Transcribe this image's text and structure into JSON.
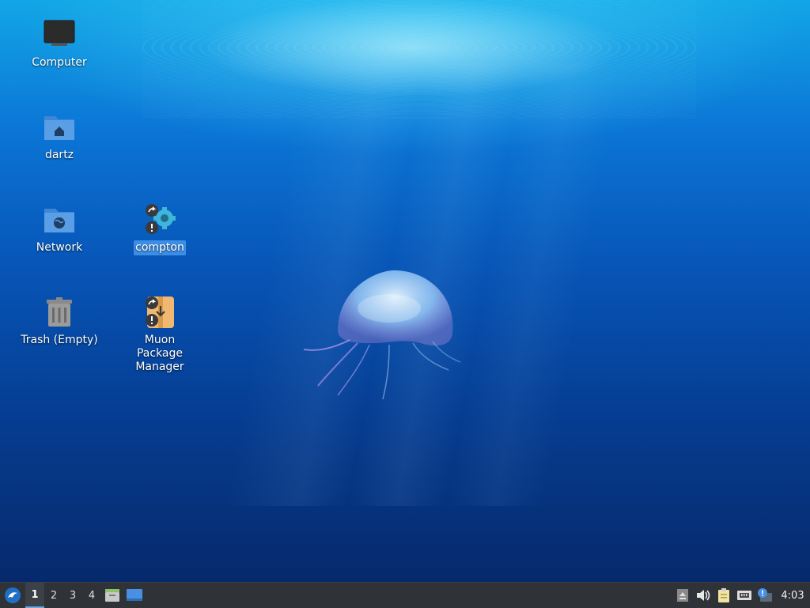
{
  "desktop": {
    "icons": [
      {
        "label": "Computer"
      },
      {
        "label": "dartz"
      },
      {
        "label": "Network"
      },
      {
        "label": "compton"
      },
      {
        "label": "Trash (Empty)"
      },
      {
        "label": "Muon Package Manager"
      }
    ],
    "selected_icon": "compton"
  },
  "taskbar": {
    "workspaces": [
      "1",
      "2",
      "3",
      "4"
    ],
    "active_workspace": "1",
    "clock": "4:03"
  },
  "colors": {
    "accent": "#3d8ee6",
    "panel": "#2f3237"
  }
}
